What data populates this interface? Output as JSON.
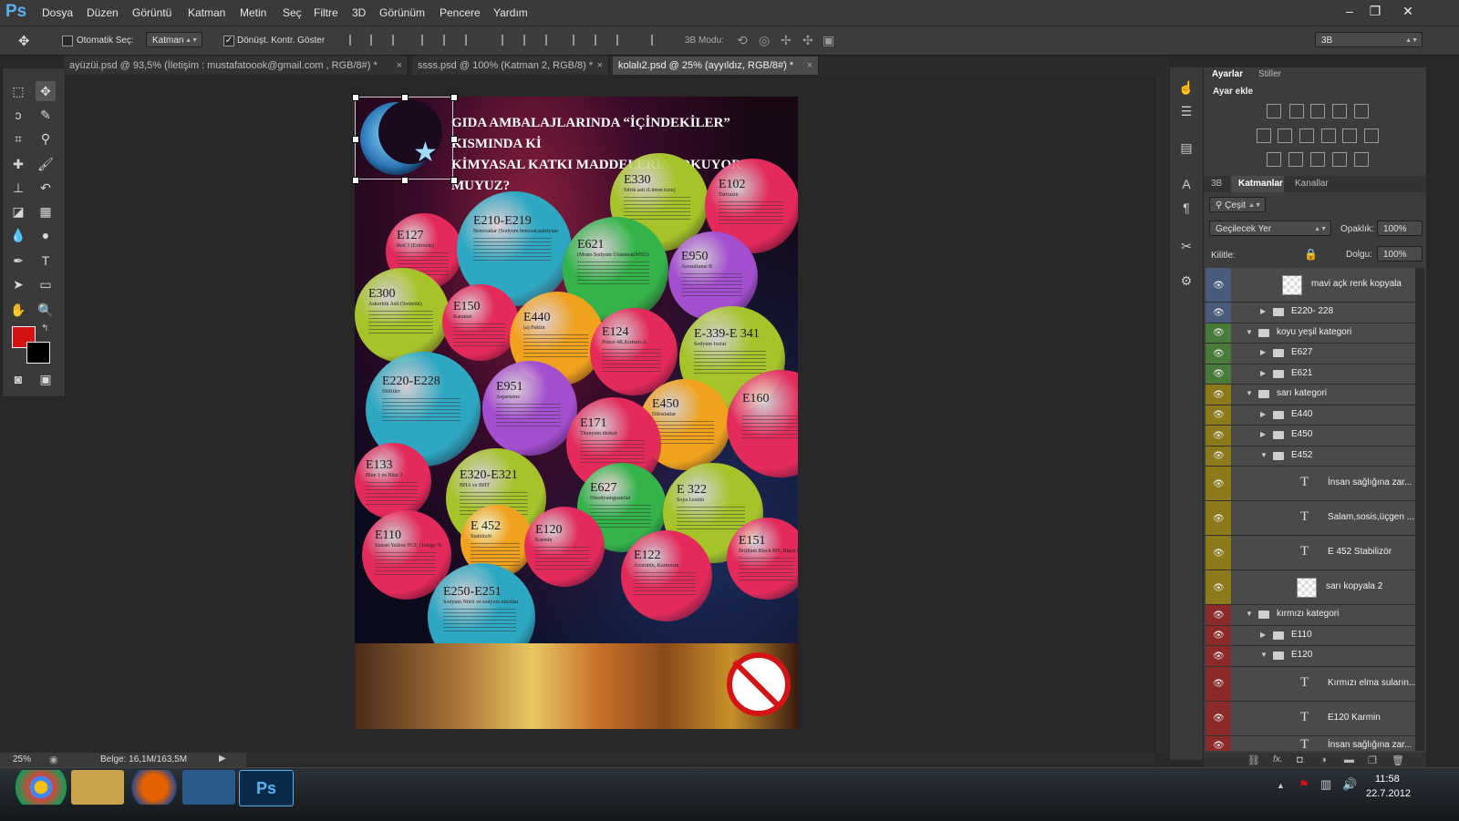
{
  "app": {
    "logo": "Ps",
    "brand_color": "#59b2f0"
  },
  "menu": [
    "Dosya",
    "Düzen",
    "Görüntü",
    "Katman",
    "Metin",
    "Seç",
    "Filtre",
    "3D",
    "Görünüm",
    "Pencere",
    "Yardım"
  ],
  "window_controls": {
    "minimize": "–",
    "restore": "❐",
    "close": "✕"
  },
  "options": {
    "auto_select_label": "Otomatik Seç:",
    "auto_select_target": "Katman",
    "transform_label": "Dönüşt. Kontr. Göster",
    "mode_3d_label": "3B Modu:",
    "workspace": "3B"
  },
  "tabs": [
    {
      "label": "ayüzüi.psd @ 93,5% (İletişim :  mustafatoook@gmail.com  , RGB/8#) *",
      "active": false
    },
    {
      "label": "ssss.psd @ 100% (Katman 2, RGB/8) *",
      "active": false
    },
    {
      "label": "kolalı2.psd @ 25% (ayyıldız, RGB/8#) *",
      "active": true
    }
  ],
  "tab_close": "×",
  "poster": {
    "title_line1": "GIDA AMBALAJLARINDA “İÇİNDEKİLER” KISMINDA Kİ",
    "title_line2": "KİMYASAL KATKI MADDELERİNİ  OKUYOR MUYUZ?",
    "balls": [
      {
        "code": "E330",
        "sub": "Sitrik asit (Limon tuzu)",
        "color": "#a6c42a"
      },
      {
        "code": "E102",
        "sub": "Tartrazin",
        "color": "#e32a5a"
      },
      {
        "code": "E127",
        "sub": "Red 3 (Eritrozin)",
        "color": "#e32a5a"
      },
      {
        "code": "E210-E219",
        "sub": "Benzoatlar (Sodyum benzoat,kalsiyum benzoat...)",
        "color": "#2ea8c2"
      },
      {
        "code": "E621",
        "sub": "(Mono Sodyum Glutamat(MSG)",
        "color": "#33b34a"
      },
      {
        "code": "E950",
        "sub": "Acesulfame K",
        "color": "#a34fcf"
      },
      {
        "code": "E300",
        "sub": "Askorbik Asit (Sentetik)",
        "color": "#a6c42a"
      },
      {
        "code": "E150",
        "sub": "Karamel",
        "color": "#e32a5a"
      },
      {
        "code": "E440",
        "sub": "(a) Pektin",
        "color": "#f0a21e"
      },
      {
        "code": "E124",
        "sub": "Ponce 4R,Kırmızı A",
        "color": "#e32a5a"
      },
      {
        "code": "E-339-E 341",
        "sub": "Sodyum fosfat",
        "color": "#a6c42a"
      },
      {
        "code": "E220-E228",
        "sub": "Sülfitler",
        "color": "#2ea8c2"
      },
      {
        "code": "E951",
        "sub": "Aspartame",
        "color": "#a34fcf"
      },
      {
        "code": "E450",
        "sub": "Difosfatlar",
        "color": "#f0a21e"
      },
      {
        "code": "E160",
        "sub": "",
        "color": "#e32a5a"
      },
      {
        "code": "E171",
        "sub": "Titanyum dioksit",
        "color": "#e32a5a"
      },
      {
        "code": "E133",
        "sub": "Blue 1 ve Blue 2",
        "color": "#e32a5a"
      },
      {
        "code": "E320-E321",
        "sub": "BHA ve BHT",
        "color": "#a6c42a"
      },
      {
        "code": "E627",
        "sub": "Disodyumguanilat",
        "color": "#33b34a"
      },
      {
        "code": "E 322",
        "sub": "Soya Lesitin",
        "color": "#a6c42a"
      },
      {
        "code": "E110",
        "sub": "Sunset Yellow FCF, Orange Yellow S",
        "color": "#e32a5a"
      },
      {
        "code": "E 452",
        "sub": "Stabilizör",
        "color": "#f0a21e"
      },
      {
        "code": "E120",
        "sub": "Karmin",
        "color": "#e32a5a"
      },
      {
        "code": "E151",
        "sub": "Brilliant Black BN, Black PN",
        "color": "#e32a5a"
      },
      {
        "code": "E122",
        "sub": "Azorubin, Karmosin",
        "color": "#e32a5a"
      },
      {
        "code": "E250-E251",
        "sub": "Sodyum Nitrit ve sodyum nitratlar",
        "color": "#2ea8c2"
      }
    ]
  },
  "status": {
    "zoom": "25%",
    "doc_label": "Belge: 16,1M/163,5M"
  },
  "panels": {
    "top_tabs": [
      "Ayarlar",
      "Stiller"
    ],
    "adjust_title": "Ayar ekle",
    "layer_tabs": [
      "3B",
      "Katmanlar",
      "Kanallar"
    ],
    "filter_label": "Çeşit",
    "blend_mode": "Geçilecek Yer",
    "opacity_label": "Opaklık:",
    "opacity_value": "100%",
    "lock_label": "Kilitle:",
    "fill_label": "Dolgu:",
    "fill_value": "100%",
    "fx_label": "fx."
  },
  "layers": [
    {
      "name": "mavi açk renk kopyala",
      "kind": "thumb",
      "color": "#4a5a7a",
      "indent": 2,
      "tri": "",
      "tall": true
    },
    {
      "name": "E220- 228",
      "kind": "folder",
      "color": "#4a5a7a",
      "indent": 2,
      "tri": "▶"
    },
    {
      "name": "koyu yeşil kategori",
      "kind": "folder",
      "color": "#4a7a3a",
      "indent": 1,
      "tri": "▼"
    },
    {
      "name": "E627",
      "kind": "folder",
      "color": "#4a7a3a",
      "indent": 2,
      "tri": "▶"
    },
    {
      "name": "E621",
      "kind": "folder",
      "color": "#4a7a3a",
      "indent": 2,
      "tri": "▶"
    },
    {
      "name": "sarı kategori",
      "kind": "folder",
      "color": "#8a7a1a",
      "indent": 1,
      "tri": "▼"
    },
    {
      "name": "E440",
      "kind": "folder",
      "color": "#8a7a1a",
      "indent": 2,
      "tri": "▶"
    },
    {
      "name": "E450",
      "kind": "folder",
      "color": "#8a7a1a",
      "indent": 2,
      "tri": "▶"
    },
    {
      "name": "E452",
      "kind": "folder",
      "color": "#8a7a1a",
      "indent": 2,
      "tri": "▼"
    },
    {
      "name": "İnsan sağlığına zar...",
      "kind": "text",
      "color": "#8a7a1a",
      "indent": 3,
      "tri": "",
      "tall": true
    },
    {
      "name": "Salam,sosis,üçgen ...",
      "kind": "text",
      "color": "#8a7a1a",
      "indent": 3,
      "tri": "",
      "tall": true
    },
    {
      "name": "E 452  Stabilizör",
      "kind": "text",
      "color": "#8a7a1a",
      "indent": 3,
      "tri": "",
      "tall": true
    },
    {
      "name": "sarı kopyala 2",
      "kind": "thumb",
      "color": "#8a7a1a",
      "indent": 3,
      "tri": "",
      "tall": true
    },
    {
      "name": "kırmızı kategori",
      "kind": "folder",
      "color": "#8a2a2a",
      "indent": 1,
      "tri": "▼"
    },
    {
      "name": "E110",
      "kind": "folder",
      "color": "#8a2a2a",
      "indent": 2,
      "tri": "▶"
    },
    {
      "name": "E120",
      "kind": "folder",
      "color": "#8a2a2a",
      "indent": 2,
      "tri": "▼"
    },
    {
      "name": "Kırmızı elma suların...",
      "kind": "text",
      "color": "#8a2a2a",
      "indent": 3,
      "tri": "",
      "tall": true
    },
    {
      "name": "E120  Karmin",
      "kind": "text",
      "color": "#8a2a2a",
      "indent": 3,
      "tri": "",
      "tall": true
    },
    {
      "name": "İnsan sağlığına zar...",
      "kind": "text",
      "color": "#8a2a2a",
      "indent": 3,
      "tri": "",
      "tall": false
    }
  ],
  "taskbar": {
    "time": "11:58",
    "date": "22.7.2012"
  }
}
